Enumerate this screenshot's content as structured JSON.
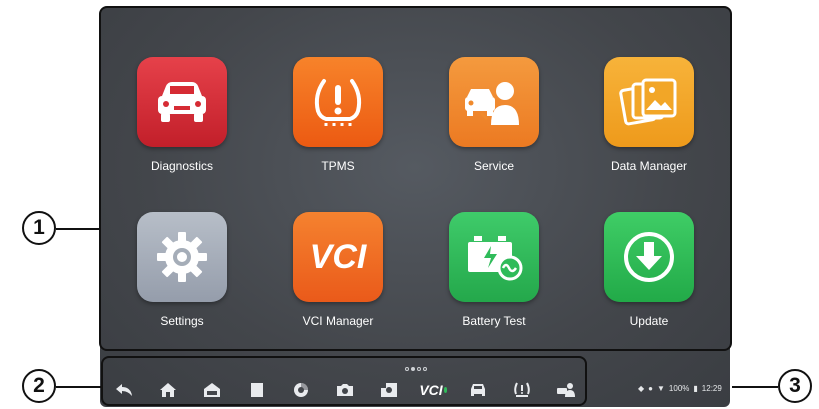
{
  "apps": [
    {
      "label": "Diagnostics",
      "icon": "car-front-icon",
      "color": "#d62b34"
    },
    {
      "label": "TPMS",
      "icon": "tire-warning-icon",
      "color": "#f26a1b"
    },
    {
      "label": "Service",
      "icon": "service-person-icon",
      "color": "#f08a2c"
    },
    {
      "label": "Data Manager",
      "icon": "photo-gallery-icon",
      "color": "#f2a627"
    },
    {
      "label": "Settings",
      "icon": "gear-icon",
      "color": "#a5adb8"
    },
    {
      "label": "VCI Manager",
      "icon": "vci-icon",
      "color": "#f06a25",
      "glyph": "VCI"
    },
    {
      "label": "Battery Test",
      "icon": "battery-icon",
      "color": "#2fbb5a"
    },
    {
      "label": "Update",
      "icon": "download-arrow-icon",
      "color": "#2dbf55"
    }
  ],
  "page_indicator": {
    "pages": 4,
    "active": 1
  },
  "navbar": {
    "vci_label": "VCI",
    "items": [
      "back-icon",
      "home-icon",
      "car-home-icon",
      "recent-apps-icon",
      "browser-icon",
      "camera-icon",
      "screenshot-icon",
      "vci-nav-icon",
      "car-nav-icon",
      "tpms-nav-icon",
      "service-nav-icon"
    ]
  },
  "status_bar": {
    "battery": "100%",
    "time": "12:29"
  },
  "callouts": {
    "one": "1",
    "two": "2",
    "three": "3"
  }
}
